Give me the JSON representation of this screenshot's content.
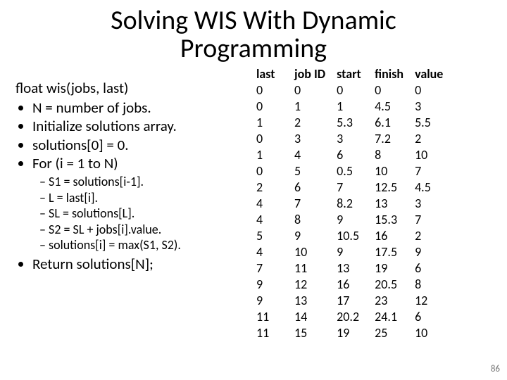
{
  "title_line1": "Solving WIS With Dynamic",
  "title_line2": "Programming",
  "pseudocode": {
    "signature": "float wis(jobs, last)",
    "steps": [
      "N = number of jobs.",
      "Initialize solutions array.",
      "solutions[0] = 0.",
      "For (i = 1 to N)"
    ],
    "inner": [
      "S1 = solutions[i-1].",
      "L = last[i].",
      "SL = solutions[L].",
      "S2 = SL + jobs[i].value.",
      "solutions[i] = max(S1, S2)."
    ],
    "ret": "Return solutions[N];"
  },
  "table": {
    "headers": [
      "last",
      "job ID",
      "start",
      "finish",
      "value"
    ],
    "rows": [
      [
        "0",
        "0",
        "0",
        "0",
        "0"
      ],
      [
        "0",
        "1",
        "1",
        "4.5",
        "3"
      ],
      [
        "1",
        "2",
        "5.3",
        "6.1",
        "5.5"
      ],
      [
        "0",
        "3",
        "3",
        "7.2",
        "2"
      ],
      [
        "1",
        "4",
        "6",
        "8",
        "10"
      ],
      [
        "0",
        "5",
        "0.5",
        "10",
        "7"
      ],
      [
        "2",
        "6",
        "7",
        "12.5",
        "4.5"
      ],
      [
        "4",
        "7",
        "8.2",
        "13",
        "3"
      ],
      [
        "4",
        "8",
        "9",
        "15.3",
        "7"
      ],
      [
        "5",
        "9",
        "10.5",
        "16",
        "2"
      ],
      [
        "4",
        "10",
        "9",
        "17.5",
        "9"
      ],
      [
        "7",
        "11",
        "13",
        "19",
        "6"
      ],
      [
        "9",
        "12",
        "16",
        "20.5",
        "8"
      ],
      [
        "9",
        "13",
        "17",
        "23",
        "12"
      ],
      [
        "11",
        "14",
        "20.2",
        "24.1",
        "6"
      ],
      [
        "11",
        "15",
        "19",
        "25",
        "10"
      ]
    ]
  },
  "page_number": "86"
}
